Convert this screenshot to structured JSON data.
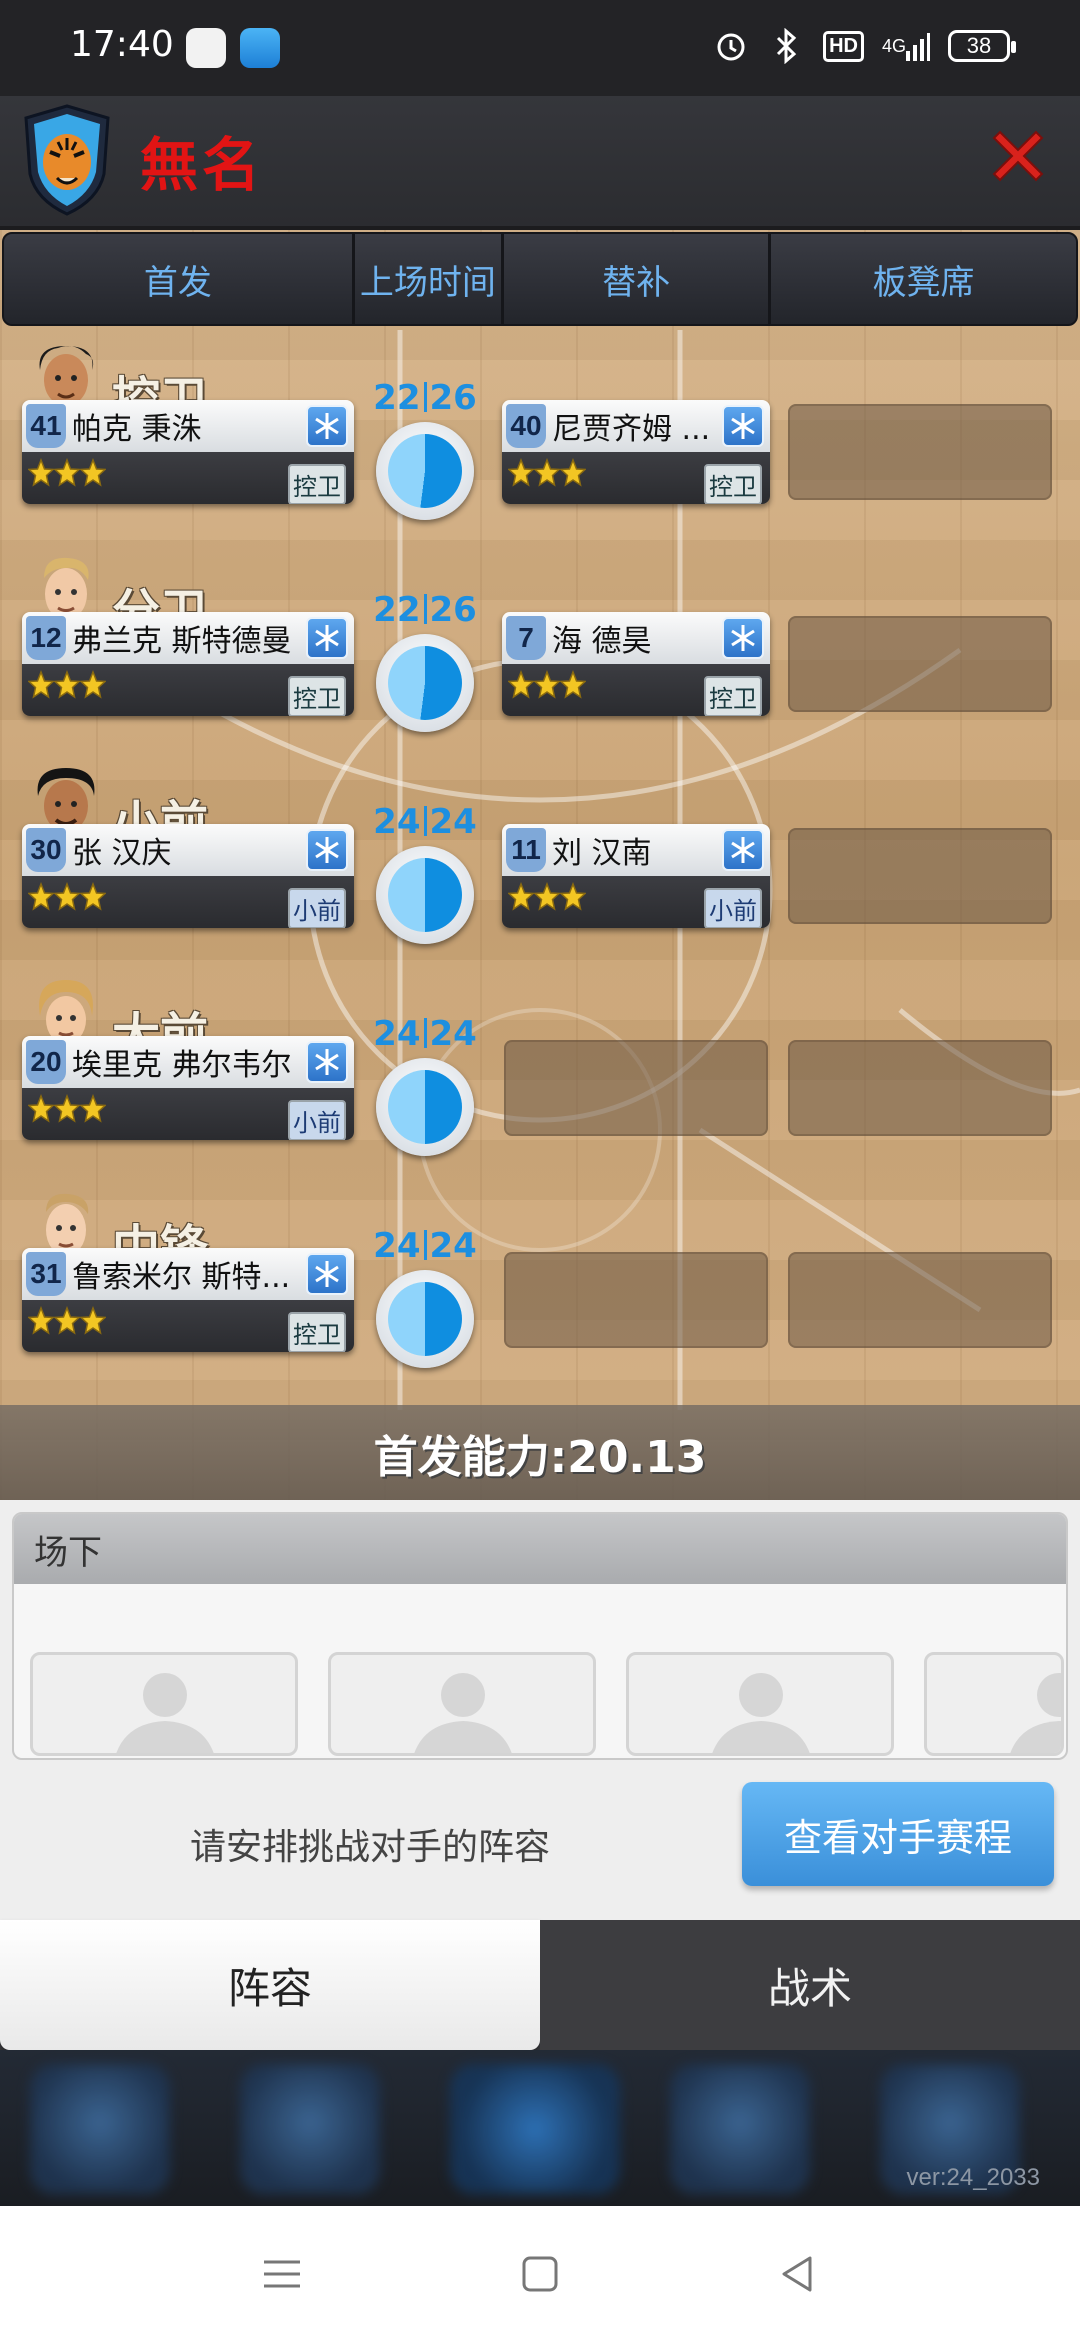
{
  "status_bar": {
    "time": "17:40",
    "battery": "38",
    "hd_label": "HD",
    "network_label": "4G"
  },
  "header": {
    "team_name": "無名"
  },
  "lineup_tabs": [
    {
      "label": "首发"
    },
    {
      "label": "上场时间"
    },
    {
      "label": "替补"
    },
    {
      "label": "板凳席"
    }
  ],
  "positions": [
    {
      "name": "控卫",
      "time_a": "22",
      "time_b": "26",
      "minutes_share": 0.85,
      "starter": {
        "number": "41",
        "name": "帕克 秉洙",
        "stars": 3,
        "pos": "控卫"
      },
      "sub": {
        "number": "40",
        "name": "尼贾齐姆 ...",
        "stars": 3,
        "pos": "控卫"
      }
    },
    {
      "name": "分卫",
      "time_a": "22",
      "time_b": "26",
      "minutes_share": 0.85,
      "starter": {
        "number": "12",
        "name": "弗兰克 斯特德曼",
        "stars": 3,
        "pos": "控卫"
      },
      "sub": {
        "number": "7",
        "name": "海 德昊",
        "stars": 3,
        "pos": "控卫"
      }
    },
    {
      "name": "小前",
      "time_a": "24",
      "time_b": "24",
      "minutes_share": 1.0,
      "starter": {
        "number": "30",
        "name": "张 汉庆",
        "stars": 3,
        "pos": "小前"
      },
      "sub": {
        "number": "11",
        "name": "刘 汉南",
        "stars": 3,
        "pos": "小前"
      }
    },
    {
      "name": "大前",
      "time_a": "24",
      "time_b": "24",
      "minutes_share": 1.0,
      "starter": {
        "number": "20",
        "name": "埃里克 弗尔韦尔",
        "stars": 3,
        "pos": "小前"
      },
      "sub": null
    },
    {
      "name": "中锋",
      "time_a": "24",
      "time_b": "24",
      "minutes_share": 1.0,
      "starter": {
        "number": "31",
        "name": "鲁索米尔 斯特...",
        "stars": 3,
        "pos": "控卫"
      },
      "sub": null
    }
  ],
  "starting_power": "首发能力:20.13",
  "bench": {
    "title": "场下"
  },
  "hint": "请安排挑战对手的阵容",
  "schedule_button": "查看对手赛程",
  "bottom_tabs": [
    {
      "label": "阵容"
    },
    {
      "label": "战术"
    }
  ],
  "version": "ver:24_2033",
  "colors": {
    "accent_blue": "#1d8fe0",
    "team_red": "#e21414",
    "star_gold": "#f3c623"
  }
}
